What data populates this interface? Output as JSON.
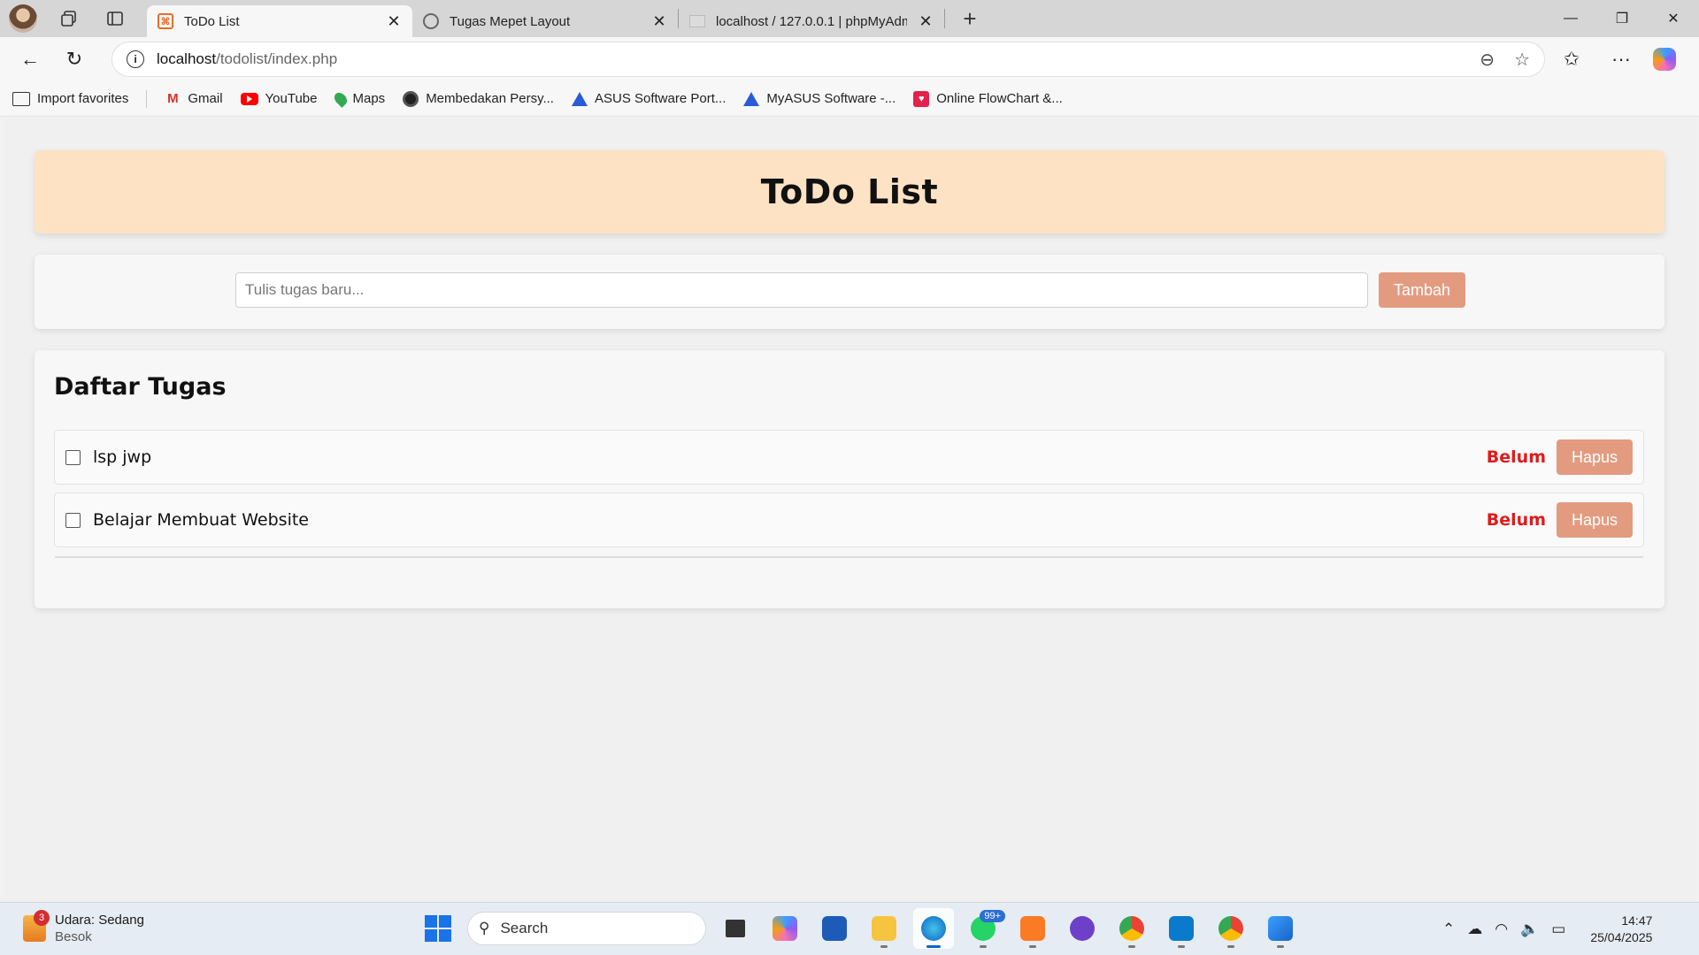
{
  "browser": {
    "tabs": [
      {
        "title": "ToDo List",
        "active": true
      },
      {
        "title": "Tugas Mepet Layout",
        "active": false
      },
      {
        "title": "localhost / 127.0.0.1 | phpMyAdm",
        "active": false
      }
    ],
    "url_host": "localhost",
    "url_path": "/todolist/index.php",
    "favorites": [
      {
        "label": "Import favorites",
        "icon": "import-icon"
      },
      {
        "label": "Gmail",
        "icon": "gmail-icon"
      },
      {
        "label": "YouTube",
        "icon": "youtube-icon"
      },
      {
        "label": "Maps",
        "icon": "maps-icon"
      },
      {
        "label": "Membedakan Persy...",
        "icon": "openai-icon"
      },
      {
        "label": "ASUS Software Port...",
        "icon": "asus-icon"
      },
      {
        "label": "MyASUS Software -...",
        "icon": "asus-icon"
      },
      {
        "label": "Online FlowChart &...",
        "icon": "flowchart-icon"
      }
    ]
  },
  "page": {
    "title": "ToDo List",
    "input_placeholder": "Tulis tugas baru...",
    "add_label": "Tambah",
    "section_title": "Daftar Tugas",
    "tasks": [
      {
        "text": "lsp jwp",
        "status": "Belum",
        "delete_label": "Hapus",
        "done": false
      },
      {
        "text": "Belajar Membuat Website",
        "status": "Belum",
        "delete_label": "Hapus",
        "done": false
      }
    ],
    "colors": {
      "header_bg": "#fde3c4",
      "button": "#e39b80",
      "status": "#e01b1b"
    }
  },
  "taskbar": {
    "weather_title": "Udara: Sedang",
    "weather_sub": "Besok",
    "weather_badge": "3",
    "search_label": "Search",
    "whatsapp_badge": "99+",
    "time": "14:47",
    "date": "25/04/2025"
  }
}
